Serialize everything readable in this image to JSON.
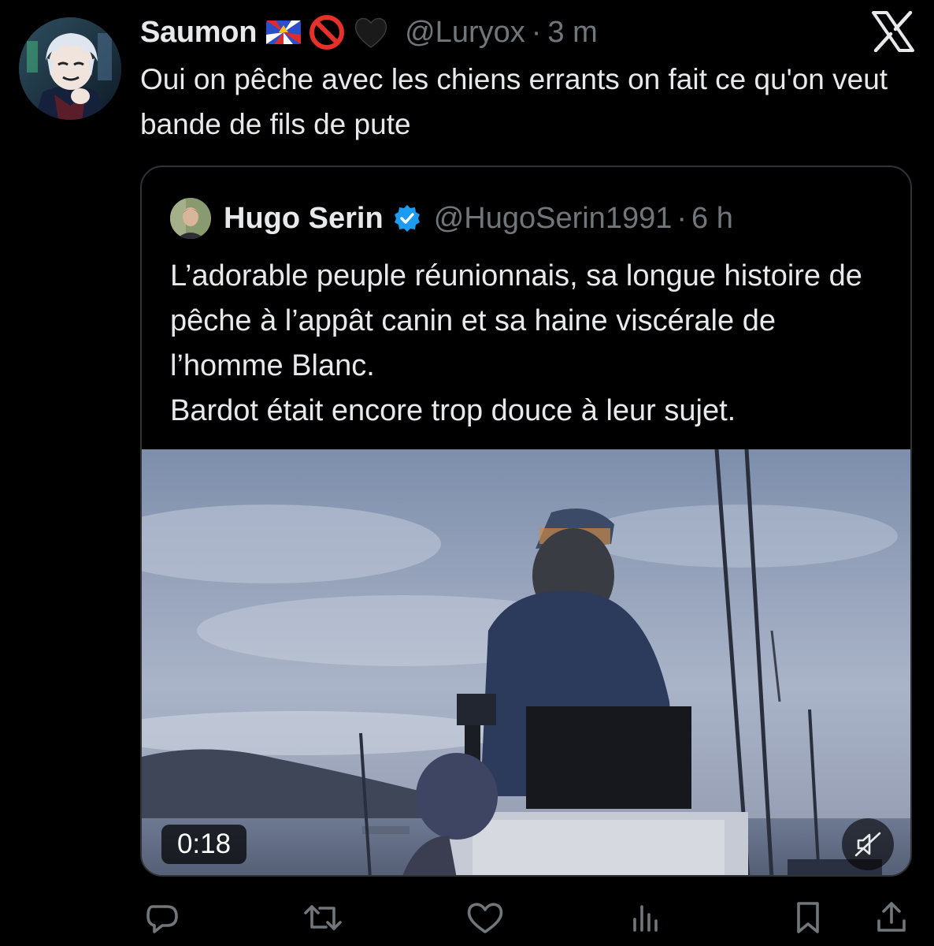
{
  "tweet": {
    "author": {
      "display_name": "Saumon",
      "handle": "@Luryox",
      "time": "3 m",
      "emojis": [
        "flag-reunion-icon",
        "prohibited-icon",
        "black-heart-icon"
      ]
    },
    "text": "Oui on pêche avec les chiens errants on fait ce qu'on veut bande de fils de pute",
    "separator": "·"
  },
  "quoted": {
    "author": {
      "display_name": "Hugo Serin",
      "handle": "@HugoSerin1991",
      "time": "6 h",
      "verified": true
    },
    "separator": "·",
    "lines": [
      "L’adorable peuple réunionnais, sa longue histoire de pêche à l’appât canin et sa haine viscérale de l’homme Blanc.",
      "Bardot était encore trop douce à leur sujet."
    ],
    "video": {
      "duration": "0:18",
      "muted": true
    }
  },
  "actions": [
    "reply-icon",
    "retweet-icon",
    "like-icon",
    "views-icon",
    "bookmark-icon",
    "share-icon"
  ],
  "colors": {
    "background": "#000000",
    "text": "#e7e9ea",
    "secondary": "#71767b",
    "border": "#2f3336",
    "verified": "#1d9bf0"
  }
}
